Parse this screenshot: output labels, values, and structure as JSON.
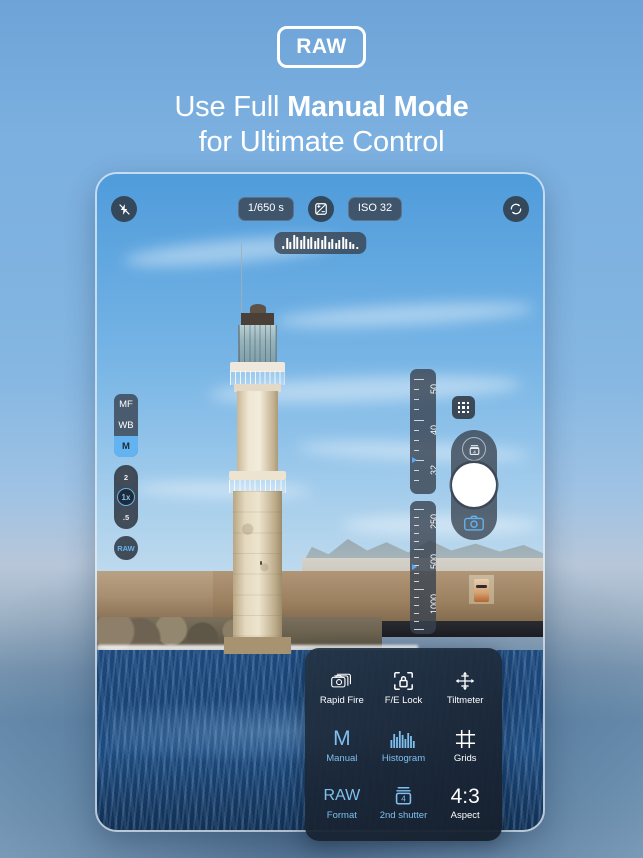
{
  "header": {
    "badge": "RAW",
    "headline_line1_prefix": "Use Full ",
    "headline_line1_bold": "Manual Mode",
    "headline_line2": "for Ultimate Control"
  },
  "viewfinder": {
    "topbar": {
      "flash_icon": "flash-off-icon",
      "shutter_speed": "1/650 s",
      "exposure_comp_icon": "exposure-compensation-icon",
      "iso_value": "ISO 32",
      "flip_camera_icon": "camera-flip-icon"
    },
    "histogram": {
      "icon": "histogram-widget",
      "bars": [
        3,
        11,
        7,
        14,
        12,
        9,
        13,
        10,
        12,
        8,
        11,
        9,
        13,
        7,
        10,
        6,
        9,
        12,
        10,
        7,
        5,
        2
      ]
    },
    "mode_stack": {
      "items": [
        {
          "label": "MF",
          "active": false
        },
        {
          "label": "WB",
          "active": false
        },
        {
          "label": "M",
          "active": true
        }
      ]
    },
    "zoom_stack": {
      "options": [
        {
          "label": "2",
          "active": false
        },
        {
          "label": "1x",
          "active": true
        },
        {
          "label": ".5",
          "active": false
        }
      ]
    },
    "raw_chip": "RAW",
    "iso_slider": {
      "name": "iso-slider",
      "labels": [
        "50",
        "40",
        "32"
      ],
      "marker_label": "32"
    },
    "shutter_slider": {
      "name": "shutter-speed-slider",
      "labels": [
        "250",
        "500",
        "1000",
        "1000"
      ],
      "marker_label": "500"
    },
    "grid_button_icon": "grid-apps-icon",
    "second_shutter_button": {
      "icon": "second-shutter-icon",
      "value": "4"
    },
    "shutter_button_icon": "shutter-button",
    "photo_mode_icon": "camera-icon"
  },
  "settings_panel": {
    "items": [
      {
        "icon": "rapid-fire-icon",
        "glyph": "❐",
        "label": "Rapid Fire",
        "color": "white"
      },
      {
        "icon": "fe-lock-icon",
        "glyph": "ὑ2",
        "label": "F/E Lock",
        "color": "white"
      },
      {
        "icon": "tiltmeter-icon",
        "glyph": "✜",
        "label": "Tiltmeter",
        "color": "white"
      },
      {
        "icon": "manual-mode-icon",
        "glyph": "M",
        "label": "Manual",
        "color": "blue"
      },
      {
        "icon": "histogram-icon",
        "glyph": "▐",
        "label": "Histogram",
        "color": "blue"
      },
      {
        "icon": "grids-icon",
        "glyph": "⌗",
        "label": "Grids",
        "color": "white"
      },
      {
        "icon": "raw-format-icon",
        "glyph": "RAW",
        "label": "Format",
        "color": "blue"
      },
      {
        "icon": "second-shutter-icon",
        "glyph": "4",
        "label": "2nd shutter",
        "color": "blue"
      },
      {
        "icon": "aspect-ratio-icon",
        "glyph": "4:3",
        "label": "Aspect",
        "color": "white"
      }
    ]
  },
  "colors": {
    "accent_blue": "#63b3f0",
    "panel_blue": "#7fc0ee",
    "overlay_dark": "#384250",
    "white": "#ffffff"
  }
}
